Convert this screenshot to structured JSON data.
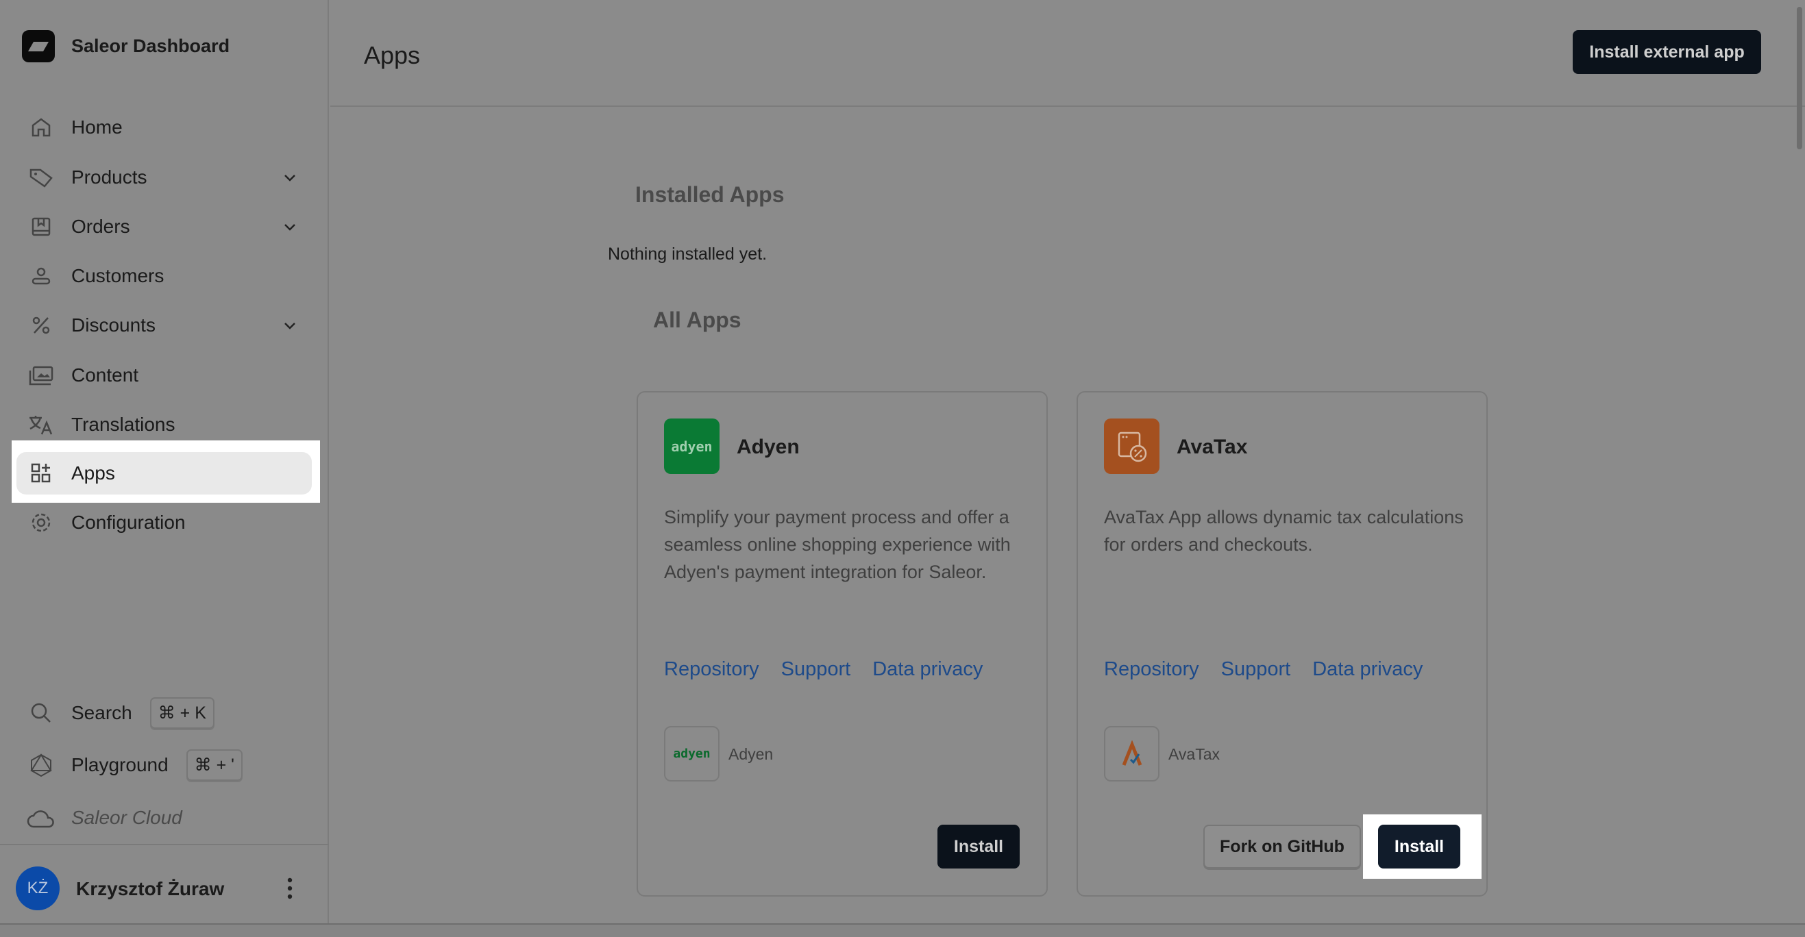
{
  "brand": {
    "title": "Saleor Dashboard"
  },
  "sidebar": {
    "items": [
      {
        "label": "Home",
        "icon": "home-icon"
      },
      {
        "label": "Products",
        "icon": "tag-icon",
        "expandable": true
      },
      {
        "label": "Orders",
        "icon": "orders-icon",
        "expandable": true
      },
      {
        "label": "Customers",
        "icon": "user-icon"
      },
      {
        "label": "Discounts",
        "icon": "percent-icon",
        "expandable": true
      },
      {
        "label": "Content",
        "icon": "content-icon"
      },
      {
        "label": "Translations",
        "icon": "translate-icon"
      },
      {
        "label": "Apps",
        "icon": "apps-icon",
        "active": true
      },
      {
        "label": "Configuration",
        "icon": "gear-icon"
      }
    ],
    "search": {
      "label": "Search",
      "shortcut": "⌘ + K"
    },
    "playground": {
      "label": "Playground",
      "shortcut": "⌘ + '"
    },
    "cloud": {
      "label": "Saleor Cloud"
    },
    "user": {
      "initials": "KŻ",
      "name": "Krzysztof Żuraw"
    }
  },
  "header": {
    "title": "Apps",
    "install_external": "Install external app"
  },
  "installed": {
    "title": "Installed Apps",
    "empty": "Nothing installed yet."
  },
  "all": {
    "title": "All Apps"
  },
  "apps": [
    {
      "name": "Adyen",
      "description": "Simplify your payment process and offer a seamless online shopping experience with Adyen's payment integration for Saleor.",
      "links": [
        "Repository",
        "Support",
        "Data privacy"
      ],
      "vendor": "Adyen",
      "logo_text": "adyen",
      "install": "Install",
      "color": "#0a7a34"
    },
    {
      "name": "AvaTax",
      "description": "AvaTax App allows dynamic tax calculations for orders and checkouts.",
      "links": [
        "Repository",
        "Support",
        "Data privacy"
      ],
      "vendor": "AvaTax",
      "install": "Install",
      "fork": "Fork on GitHub",
      "color": "#a4501f"
    }
  ],
  "colors": {
    "overlay": "#8b8b8b",
    "button": "#0b121b",
    "link": "#1d4a8a",
    "avatar": "#0b4aa8"
  }
}
